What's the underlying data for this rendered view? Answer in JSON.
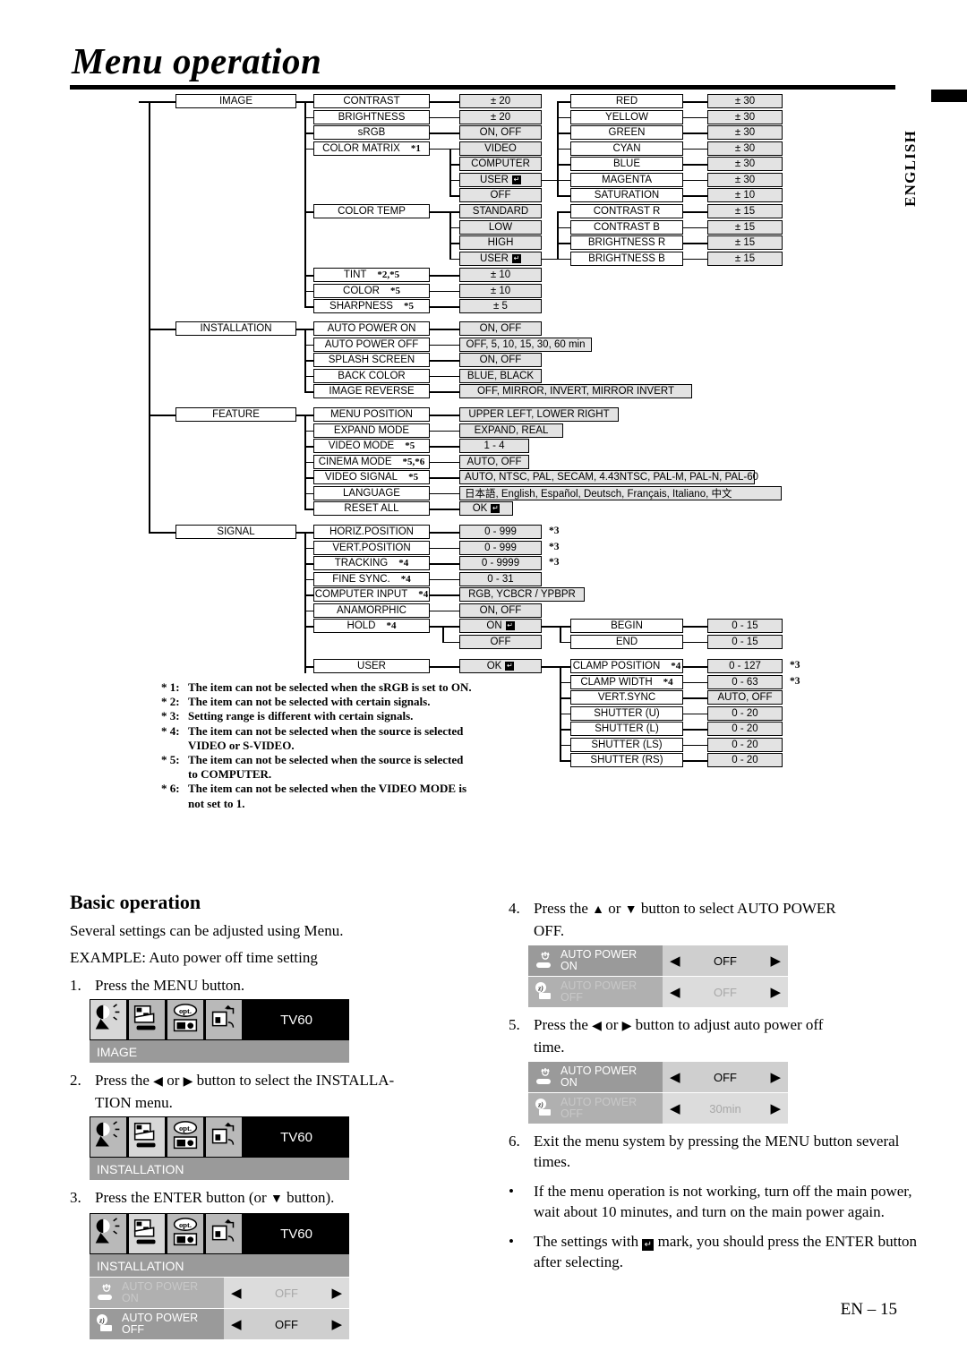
{
  "page": {
    "title": "Menu operation",
    "side_tab": "ENGLISH",
    "page_number": "EN – 15"
  },
  "tree": {
    "menus": [
      {
        "label": "IMAGE"
      },
      {
        "label": "INSTALLATION"
      },
      {
        "label": "FEATURE"
      },
      {
        "label": "SIGNAL"
      }
    ],
    "image_items": [
      {
        "label": "CONTRAST",
        "note": "",
        "value": "± 20"
      },
      {
        "label": "BRIGHTNESS",
        "note": "",
        "value": "± 20"
      },
      {
        "label": "sRGB",
        "note": "",
        "value": "ON, OFF"
      },
      {
        "label": "COLOR MATRIX",
        "note": "*1",
        "value": ""
      },
      {
        "label": "COLOR TEMP",
        "note": "",
        "value": ""
      },
      {
        "label": "TINT",
        "note": "*2,*5",
        "value": "± 10"
      },
      {
        "label": "COLOR",
        "note": "*5",
        "value": "± 10"
      },
      {
        "label": "SHARPNESS",
        "note": "*5",
        "value": "± 5"
      }
    ],
    "color_matrix_values": [
      "VIDEO",
      "COMPUTER",
      "USER",
      "OFF"
    ],
    "color_temp_values": [
      "STANDARD",
      "LOW",
      "HIGH",
      "USER"
    ],
    "color_matrix_user_items": [
      {
        "label": "RED",
        "value": "± 30"
      },
      {
        "label": "YELLOW",
        "value": "± 30"
      },
      {
        "label": "GREEN",
        "value": "± 30"
      },
      {
        "label": "CYAN",
        "value": "± 30"
      },
      {
        "label": "BLUE",
        "value": "± 30"
      },
      {
        "label": "MAGENTA",
        "value": "± 30"
      },
      {
        "label": "SATURATION",
        "value": "± 10"
      }
    ],
    "color_temp_user_items": [
      {
        "label": "CONTRAST R",
        "value": "± 15"
      },
      {
        "label": "CONTRAST B",
        "value": "± 15"
      },
      {
        "label": "BRIGHTNESS R",
        "value": "± 15"
      },
      {
        "label": "BRIGHTNESS B",
        "value": "± 15"
      }
    ],
    "installation_items": [
      {
        "label": "AUTO POWER ON",
        "value": "ON, OFF"
      },
      {
        "label": "AUTO POWER OFF",
        "value": "OFF, 5, 10, 15, 30, 60 min"
      },
      {
        "label": "SPLASH SCREEN",
        "value": "ON, OFF"
      },
      {
        "label": "BACK COLOR",
        "value": "BLUE, BLACK"
      },
      {
        "label": "IMAGE REVERSE",
        "value": "OFF, MIRROR, INVERT, MIRROR INVERT"
      }
    ],
    "feature_items": [
      {
        "label": "MENU POSITION",
        "note": "",
        "value": "UPPER LEFT, LOWER RIGHT"
      },
      {
        "label": "EXPAND MODE",
        "note": "",
        "value": "EXPAND, REAL"
      },
      {
        "label": "VIDEO MODE",
        "note": "*5",
        "value": "1 - 4"
      },
      {
        "label": "CINEMA MODE",
        "note": "*5,*6",
        "value": "AUTO, OFF"
      },
      {
        "label": "VIDEO SIGNAL",
        "note": "*5",
        "value": "AUTO, NTSC, PAL, SECAM, 4.43NTSC, PAL-M, PAL-N, PAL-60"
      },
      {
        "label": "LANGUAGE",
        "note": "",
        "value": "日本語, English, Español, Deutsch, Français, Italiano, 中文"
      },
      {
        "label": "RESET ALL",
        "note": "",
        "value": "OK"
      }
    ],
    "signal_items": [
      {
        "label": "HORIZ.POSITION",
        "note": "",
        "value": "0 - 999",
        "star": "*3"
      },
      {
        "label": "VERT.POSITION",
        "note": "",
        "value": "0 - 999",
        "star": "*3"
      },
      {
        "label": "TRACKING",
        "note": "*4",
        "value": "0 - 9999",
        "star": "*3"
      },
      {
        "label": "FINE SYNC.",
        "note": "*4",
        "value": "0 - 31",
        "star": ""
      },
      {
        "label": "COMPUTER INPUT",
        "note": "*4",
        "value": "RGB, YCBCR / YPBPR",
        "star": ""
      },
      {
        "label": "ANAMORPHIC",
        "note": "",
        "value": "ON, OFF",
        "star": ""
      },
      {
        "label": "HOLD",
        "note": "*4",
        "value": "ON",
        "star": ""
      }
    ],
    "hold_off_value": "OFF",
    "hold_sub_items": [
      {
        "label": "BEGIN",
        "value": "0 - 15"
      },
      {
        "label": "END",
        "value": "0 - 15"
      }
    ],
    "user_item": {
      "label": "USER",
      "value": "OK"
    },
    "user_sub_items": [
      {
        "label": "CLAMP POSITION",
        "note": "*4",
        "value": "0 - 127",
        "star": "*3"
      },
      {
        "label": "CLAMP WIDTH",
        "note": "*4",
        "value": "0 - 63",
        "star": "*3"
      },
      {
        "label": "VERT.SYNC",
        "note": "",
        "value": "AUTO, OFF",
        "star": ""
      },
      {
        "label": "SHUTTER (U)",
        "note": "",
        "value": "0 - 20",
        "star": ""
      },
      {
        "label": "SHUTTER (L)",
        "note": "",
        "value": "0 - 20",
        "star": ""
      },
      {
        "label": "SHUTTER (LS)",
        "note": "",
        "value": "0 - 20",
        "star": ""
      },
      {
        "label": "SHUTTER (RS)",
        "note": "",
        "value": "0 - 20",
        "star": ""
      }
    ]
  },
  "footnotes": [
    {
      "num": "* 1:",
      "text": "The item can not be selected when the sRGB is set to ON.",
      "cont": ""
    },
    {
      "num": "* 2:",
      "text": "The item can not be selected with certain signals.",
      "cont": ""
    },
    {
      "num": "* 3:",
      "text": "Setting range is different with certain signals.",
      "cont": ""
    },
    {
      "num": "* 4:",
      "text": "The item can not be selected when the source is selected",
      "cont": "VIDEO or S-VIDEO."
    },
    {
      "num": "* 5:",
      "text": "The item can not be selected when the source is selected",
      "cont": "to COMPUTER."
    },
    {
      "num": "* 6:",
      "text": "The item can not be selected when the VIDEO MODE is",
      "cont": "not set to 1."
    }
  ],
  "basic": {
    "heading": "Basic operation",
    "intro": "Several settings can be adjusted using Menu.",
    "example": "EXAMPLE: Auto power off time setting",
    "step1": {
      "num": "1.",
      "text": "Press the MENU button."
    },
    "step2": {
      "num": "2.",
      "text_a": "Press the ",
      "text_b": " or ",
      "text_c": " button to select the INSTALLA-",
      "text_d": "TION menu."
    },
    "step3": {
      "num": "3.",
      "text_a": "Press the ENTER button (or ",
      "text_b": " button)."
    },
    "step4": {
      "num": "4.",
      "text_a": "Press the ",
      "text_b": " or ",
      "text_c": " button to select AUTO POWER",
      "text_d": "OFF."
    },
    "step5": {
      "num": "5.",
      "text_a": "Press the ",
      "text_b": " or ",
      "text_c": " button to adjust auto power off",
      "text_d": "time."
    },
    "step6": {
      "num": "6.",
      "text": "Exit the menu system by pressing the MENU button several times."
    },
    "bullet1": "If the menu operation is not working, turn off the main power, wait about 10 minutes, and turn on the main power again.",
    "bullet2_a": "The settings with ",
    "bullet2_b": " mark, you should press the ENTER button after selecting."
  },
  "osd": {
    "source_label": "TV60",
    "opt_label": "opt.",
    "tabs": [
      "image-tab",
      "installation-tab",
      "feature-tab",
      "signal-tab"
    ],
    "shot1": {
      "menu": "IMAGE",
      "active_tab": 0
    },
    "shot2": {
      "menu": "INSTALLATION",
      "active_tab": 1
    },
    "shot3": {
      "menu": "INSTALLATION",
      "active_tab": 1,
      "rows": [
        {
          "label_line1": "AUTO POWER",
          "label_line2": "ON",
          "value": "OFF",
          "dim": true
        },
        {
          "label_line1": "AUTO POWER",
          "label_line2": "OFF",
          "value": "OFF",
          "dim": false
        }
      ]
    },
    "shot4": {
      "rows": [
        {
          "label_line1": "AUTO POWER",
          "label_line2": "ON",
          "value": "OFF",
          "dim": false
        },
        {
          "label_line1": "AUTO POWER",
          "label_line2": "OFF",
          "value": "OFF",
          "dim": true
        }
      ]
    },
    "shot5": {
      "rows": [
        {
          "label_line1": "AUTO POWER",
          "label_line2": "ON",
          "value": "OFF",
          "dim": false
        },
        {
          "label_line1": "AUTO POWER",
          "label_line2": "OFF",
          "value": "30min",
          "dim": true
        }
      ]
    },
    "arrow_left": "◀",
    "arrow_right": "▶"
  },
  "colors": {
    "box_fill": "#e3e3e3",
    "osd_label_bg": "#9a9a9a",
    "osd_value_bg": "#cfcfcf",
    "line": "#000000"
  }
}
